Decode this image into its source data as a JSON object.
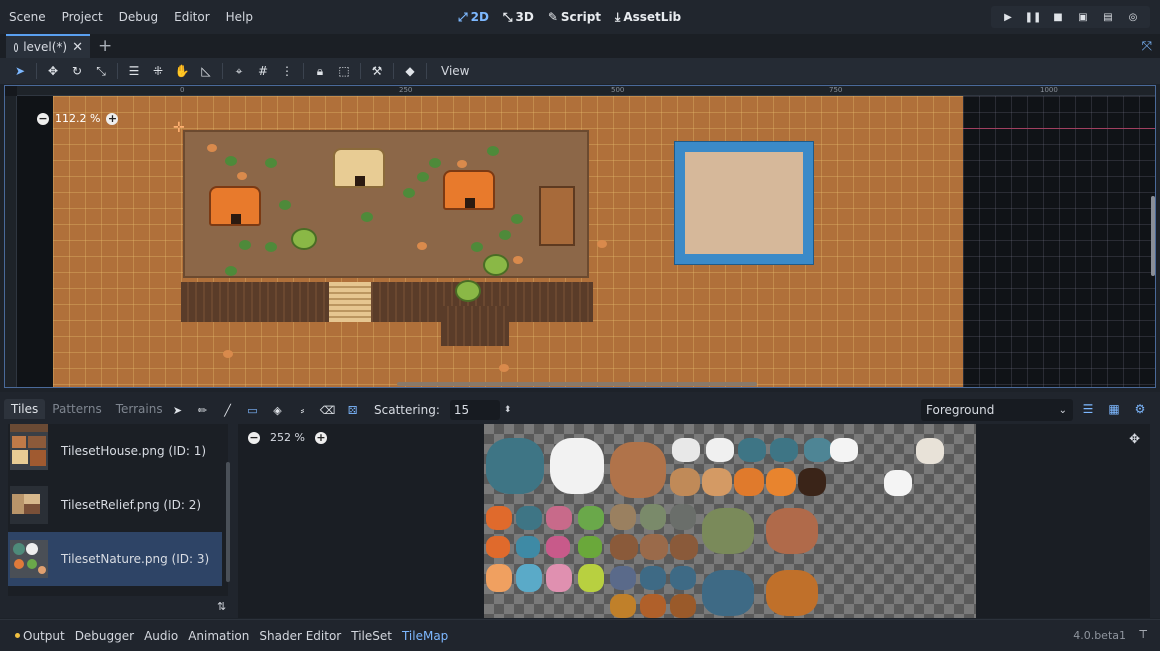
{
  "menu": [
    "Scene",
    "Project",
    "Debug",
    "Editor",
    "Help"
  ],
  "workspaces": [
    {
      "label": "2D",
      "icon": "2d-icon",
      "active": true
    },
    {
      "label": "3D",
      "icon": "3d-icon",
      "active": false
    },
    {
      "label": "Script",
      "icon": "script-icon",
      "active": false
    },
    {
      "label": "AssetLib",
      "icon": "assetlib-icon",
      "active": false
    }
  ],
  "scene_tab": {
    "label": "level(*)"
  },
  "toolbar": {
    "view_label": "View"
  },
  "viewport": {
    "zoom": "112.2 %",
    "ruler": [
      "0",
      "250",
      "500",
      "750",
      "1000"
    ]
  },
  "tilemap_panel": {
    "tabs": [
      "Tiles",
      "Patterns",
      "Terrains"
    ],
    "active_tab": "Tiles",
    "scattering_label": "Scattering:",
    "scattering_value": "15",
    "layer": "Foreground",
    "atlas_zoom": "252 %",
    "tilesets": [
      {
        "name": "TilesetHouse.png (ID: 1)",
        "selected": false
      },
      {
        "name": "TilesetRelief.png (ID: 2)",
        "selected": false
      },
      {
        "name": "TilesetNature.png (ID: 3)",
        "selected": true
      }
    ]
  },
  "bottom_tabs": [
    "Output",
    "Debugger",
    "Audio",
    "Animation",
    "Shader Editor",
    "TileSet",
    "TileMap"
  ],
  "active_bottom_tab": "TileMap",
  "version": "4.0.beta1",
  "colors": {
    "accent": "#7db8ff",
    "background": "#1d2229"
  }
}
